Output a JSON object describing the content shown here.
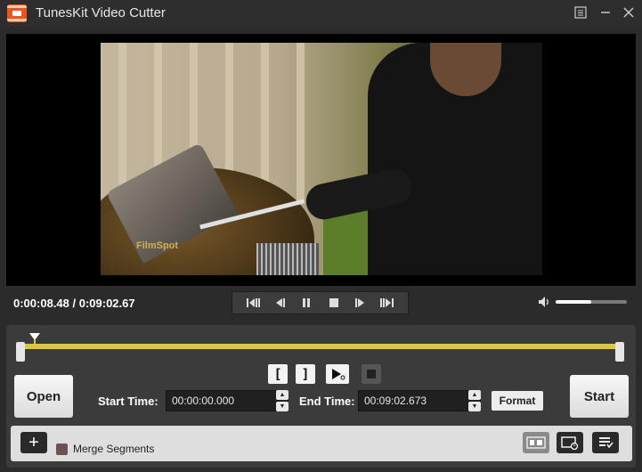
{
  "app": {
    "title": "TunesKit Video Cutter",
    "accent_color": "#e8561f"
  },
  "window_controls": [
    {
      "name": "menu-icon",
      "glyph": "☰"
    },
    {
      "name": "minimize-icon",
      "glyph": "—"
    },
    {
      "name": "close-icon",
      "glyph": "✕"
    }
  ],
  "video": {
    "watermark": "FilmSpot"
  },
  "playback": {
    "time_display": "0:00:08.48 / 0:09:02.67",
    "buttons": [
      "prev-segment-icon",
      "step-back-icon",
      "pause-icon",
      "stop-icon",
      "step-forward-icon",
      "next-segment-icon"
    ],
    "volume_level": 0.5
  },
  "timeline": {
    "track_color": "#d9c64a"
  },
  "segment_controls": {
    "mark_in": "[",
    "mark_out": "]"
  },
  "editor": {
    "open_label": "Open",
    "start_time_label": "Start Time:",
    "start_time_value": "00:00:00.000",
    "end_time_label": "End Time:",
    "end_time_value": "00:09:02.673",
    "format_label": "Format",
    "start_label": "Start"
  },
  "bottom": {
    "add_label": "+",
    "merge_label": "Merge Segments"
  }
}
